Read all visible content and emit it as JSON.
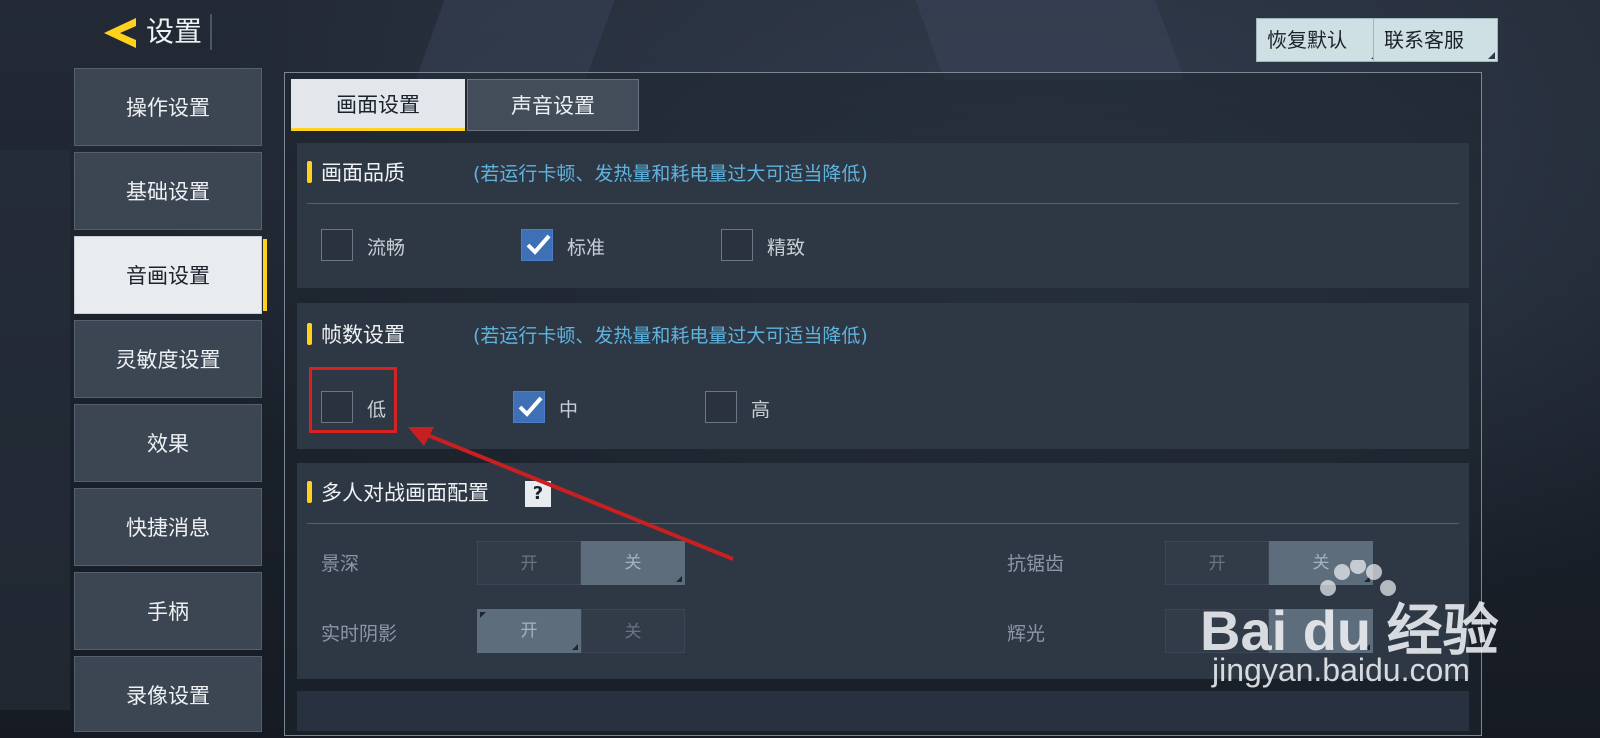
{
  "header": {
    "title": "设置",
    "restore_label": "恢复默认",
    "contact_label": "联系客服"
  },
  "sidebar": {
    "items": [
      {
        "label": "操作设置"
      },
      {
        "label": "基础设置"
      },
      {
        "label": "音画设置",
        "active": true
      },
      {
        "label": "灵敏度设置"
      },
      {
        "label": "效果"
      },
      {
        "label": "快捷消息"
      },
      {
        "label": "手柄"
      },
      {
        "label": "录像设置"
      }
    ]
  },
  "tabs": {
    "picture": "画面设置",
    "sound": "声音设置"
  },
  "quality": {
    "title": "画面品质",
    "hint": "(若运行卡顿、发热量和耗电量过大可适当降低)",
    "options": [
      {
        "label": "流畅",
        "checked": false
      },
      {
        "label": "标准",
        "checked": true
      },
      {
        "label": "精致",
        "checked": false
      }
    ]
  },
  "framerate": {
    "title": "帧数设置",
    "hint": "(若运行卡顿、发热量和耗电量过大可适当降低)",
    "options": [
      {
        "label": "低",
        "checked": false
      },
      {
        "label": "中",
        "checked": true
      },
      {
        "label": "高",
        "checked": false
      }
    ]
  },
  "multiplayer": {
    "title": "多人对战画面配置",
    "help_glyph": "?",
    "settings": [
      {
        "label": "景深",
        "on_label": "开",
        "off_label": "关",
        "value": "关"
      },
      {
        "label": "抗锯齿",
        "on_label": "开",
        "off_label": "关",
        "value": "关"
      },
      {
        "label": "实时阴影",
        "on_label": "开",
        "off_label": "关",
        "value": "开"
      },
      {
        "label": "辉光",
        "on_label": "开",
        "off_label": "关",
        "value": "开"
      }
    ]
  },
  "watermark": {
    "brand": "Bai du 经验",
    "url": "jingyan.baidu.com"
  },
  "colors": {
    "accent": "#ffd21e",
    "hint": "#5fb3df",
    "checked": "#3f6fb5",
    "annotation": "#d62222"
  }
}
